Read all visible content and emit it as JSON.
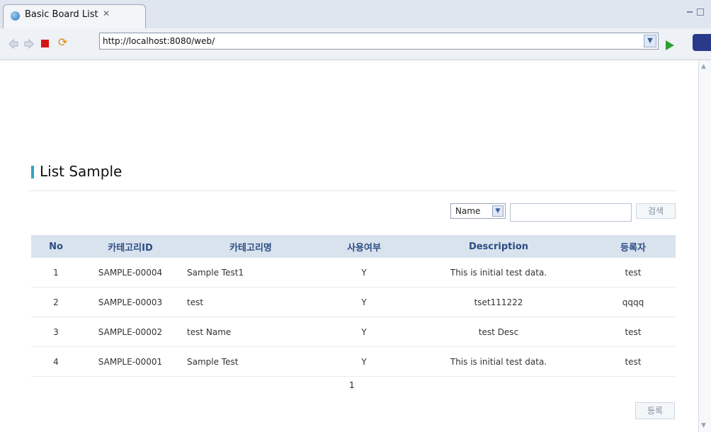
{
  "window": {
    "tab_title": "Basic Board List",
    "tab_close": "✕"
  },
  "toolbar": {
    "url": "http://localhost:8080/web/",
    "icons": [
      "back-arrow-icon",
      "forward-arrow-icon",
      "stop-icon",
      "refresh-icon",
      "go-icon"
    ]
  },
  "page": {
    "title": "List Sample"
  },
  "search": {
    "select_value": "Name",
    "input_value": "",
    "button_label": "검색"
  },
  "table": {
    "headers": [
      "No",
      "카테고리ID",
      "카테고리명",
      "사용여부",
      "Description",
      "등록자"
    ],
    "rows": [
      [
        "1",
        "SAMPLE-00004",
        "Sample Test1",
        "Y",
        "This is initial test data.",
        "test"
      ],
      [
        "2",
        "SAMPLE-00003",
        "test",
        "Y",
        "tset111222",
        "qqqq"
      ],
      [
        "3",
        "SAMPLE-00002",
        "test Name",
        "Y",
        "test Desc",
        "test"
      ],
      [
        "4",
        "SAMPLE-00001",
        "Sample Test",
        "Y",
        "This is initial test data.",
        "test"
      ]
    ]
  },
  "pagination": {
    "current": "1"
  },
  "actions": {
    "register_label": "등록"
  },
  "colors": {
    "header_bg": "#d9e3ee",
    "header_text": "#2c4d85",
    "accent": "#34a0c8"
  }
}
